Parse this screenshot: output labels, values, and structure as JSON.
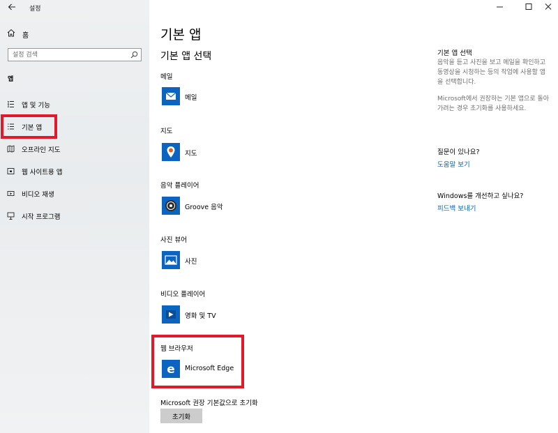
{
  "titlebar": {
    "title": "설정"
  },
  "sidebar": {
    "home_label": "홈",
    "search_placeholder": "설정 검색",
    "section_label": "앱",
    "items": [
      {
        "label": "앱 및 기능",
        "icon": "apps-features-icon"
      },
      {
        "label": "기본 앱",
        "icon": "default-apps-icon",
        "selected": true
      },
      {
        "label": "오프라인 지도",
        "icon": "offline-maps-icon"
      },
      {
        "label": "웹 사이트용 앱",
        "icon": "apps-for-websites-icon"
      },
      {
        "label": "비디오 재생",
        "icon": "video-playback-icon"
      },
      {
        "label": "시작 프로그램",
        "icon": "startup-icon"
      }
    ]
  },
  "main": {
    "title": "기본 앱",
    "subtitle": "기본 앱 선택",
    "categories": [
      {
        "label": "메일",
        "app": "메일",
        "icon": "mail-icon"
      },
      {
        "label": "지도",
        "app": "지도",
        "icon": "maps-icon"
      },
      {
        "label": "음악 플레이어",
        "app": "Groove 음악",
        "icon": "groove-music-icon"
      },
      {
        "label": "사진 뷰어",
        "app": "사진",
        "icon": "photos-icon"
      },
      {
        "label": "비디오 플레이어",
        "app": "영화 및 TV",
        "icon": "movies-tv-icon"
      },
      {
        "label": "웹 브라우저",
        "app": "Microsoft Edge",
        "icon": "edge-icon"
      }
    ],
    "reset_text": "Microsoft 권장 기본값으로 초기화",
    "reset_button": "초기화"
  },
  "right_panel": {
    "heading": "기본 앱 선택",
    "desc1": "음악을 듣고 사진을 보고 메일을 확인하고 동영상을 시청하는 등의 작업에 사용할 앱을 선택합니다.",
    "desc2": "Microsoft에서 권장하는 기본 앱으로 돌아가려는 경우 초기화를 사용하세요.",
    "question": "질문이 있나요?",
    "help_link": "도움말 보기",
    "improve": "Windows를 개선하고 싶나요?",
    "feedback_link": "피드백 보내기"
  },
  "colors": {
    "accent": "#0063b1",
    "tile": "#0b64c0",
    "highlight": "#e0192b"
  }
}
